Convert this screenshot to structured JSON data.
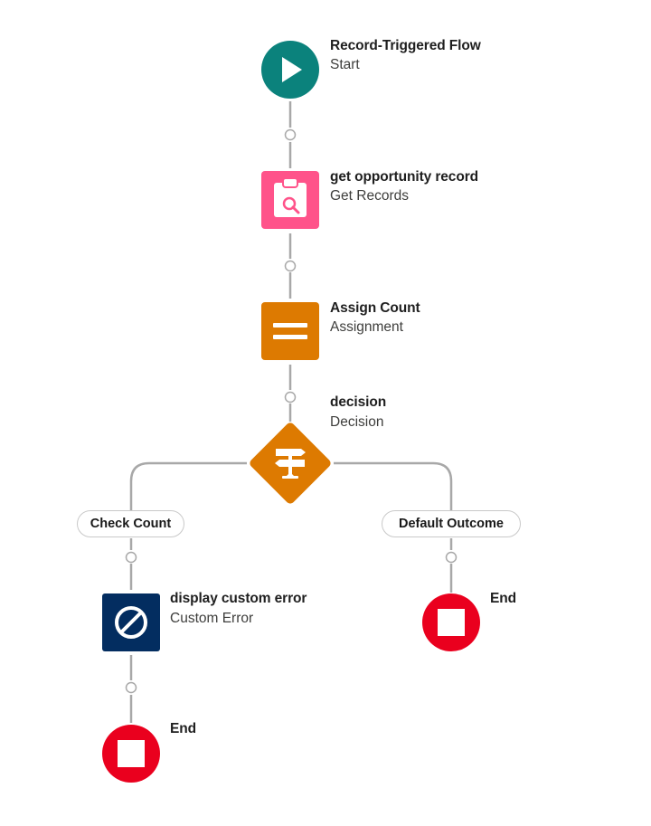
{
  "flow": {
    "colors": {
      "start": "#0b827c",
      "get_records": "#ff538a",
      "assignment": "#dd7a01",
      "decision": "#dd7a01",
      "custom_error": "#032d60",
      "end": "#ea001e",
      "connector": "#a0a0a0"
    },
    "nodes": {
      "start": {
        "title": "Record-Triggered Flow",
        "subtitle": "Start",
        "icon": "play-icon"
      },
      "get_records": {
        "title": "get opportunity record",
        "subtitle": "Get Records",
        "icon": "clipboard-search-icon"
      },
      "assignment": {
        "title": "Assign Count",
        "subtitle": "Assignment",
        "icon": "equals-icon"
      },
      "decision": {
        "title": "decision",
        "subtitle": "Decision",
        "icon": "signpost-icon"
      },
      "custom_error": {
        "title": "display custom error",
        "subtitle": "Custom Error",
        "icon": "prohibited-icon"
      },
      "end_left": {
        "title": "End",
        "icon": "stop-icon"
      },
      "end_right": {
        "title": "End",
        "icon": "stop-icon"
      }
    },
    "outcomes": [
      {
        "label": "Check Count"
      },
      {
        "label": "Default Outcome"
      }
    ]
  }
}
